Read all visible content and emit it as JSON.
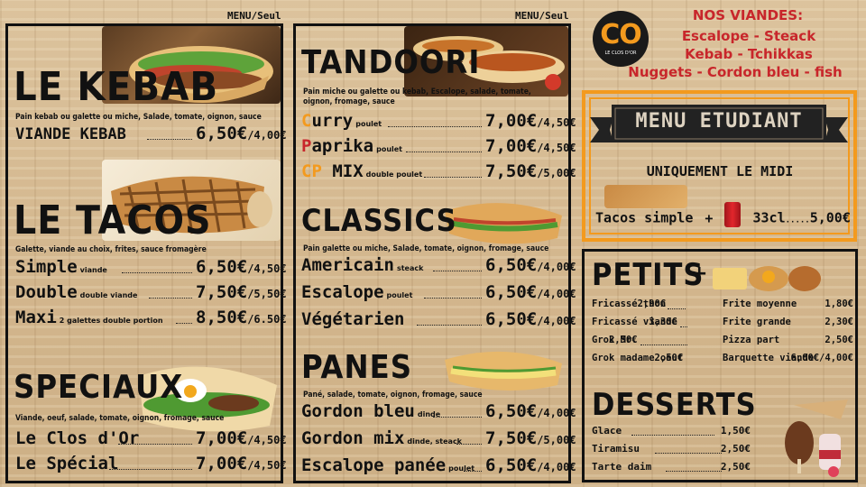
{
  "top_tags": {
    "left": "MENU/Seul",
    "middle": "MENU/Seul"
  },
  "kebab": {
    "title": "LE KEBAB",
    "desc": "Pain kebab ou galette ou miche, Salade, tomate, oignon, sauce",
    "items": [
      {
        "name": "VIANDE KEBAB",
        "sub": "",
        "price": "6,50€",
        "menu": "/4,00€"
      }
    ]
  },
  "tacos": {
    "title": "LE TACOS",
    "desc": "Galette, viande au choix, frites, sauce fromagère",
    "items": [
      {
        "name": "Simple",
        "sub": "viande",
        "price": "6,50€",
        "menu": "/4,50€"
      },
      {
        "name": "Double",
        "sub": "double viande",
        "price": "7,50€",
        "menu": "/5,50€"
      },
      {
        "name": "Maxi",
        "sub": "2 galettes double portion",
        "price": "8,50€",
        "menu": "/6.50€"
      }
    ]
  },
  "speciaux": {
    "title": "SPECIAUX",
    "desc": "Viande, oeuf, salade, tomate, oignon, fromage, sauce",
    "items": [
      {
        "name": "Le Clos d'Or",
        "sub": "",
        "price": "7,00€",
        "menu": "/4,50€"
      },
      {
        "name": "Le Spécial",
        "sub": "",
        "price": "7,00€",
        "menu": "/4,50€"
      }
    ]
  },
  "tandoori": {
    "title": "TANDOORI",
    "desc1": "Pain miche ou galette ou kebab, Escalope, salade, tomate,",
    "desc2": "oignon, fromage, sauce",
    "items": [
      {
        "first": "C",
        "rest": "urry",
        "sub": "poulet",
        "price": "7,00€",
        "menu": "/4,50€"
      },
      {
        "first": "P",
        "rest": "aprika",
        "sub": "poulet",
        "price": "7,00€",
        "menu": "/4,50€"
      },
      {
        "first": "CP",
        "rest": " MIX",
        "sub": "double poulet",
        "price": "7,50€",
        "menu": "/5,00€"
      }
    ]
  },
  "classics": {
    "title": "CLASSICS",
    "desc": "Pain galette ou miche, Salade, tomate, oignon, fromage, sauce",
    "items": [
      {
        "name": "Americain",
        "sub": "steack",
        "price": "6,50€",
        "menu": "/4,00€"
      },
      {
        "name": "Escalope",
        "sub": "poulet",
        "price": "6,50€",
        "menu": "/4,00€"
      },
      {
        "name": "Végétarien",
        "sub": "",
        "price": "6,50€",
        "menu": "/4,00€"
      }
    ]
  },
  "panes": {
    "title": "PANES",
    "desc": "Pané, salade, tomate, oignon, fromage, sauce",
    "items": [
      {
        "name": "Gordon bleu",
        "sub": "dinde",
        "price": "6,50€",
        "menu": "/4,00€"
      },
      {
        "name": "Gordon mix",
        "sub": "dinde, steack",
        "price": "7,50€",
        "menu": "/5,00€"
      },
      {
        "name": "Escalope panée",
        "sub": "poulet",
        "price": "6,50€",
        "menu": "/4,00€"
      }
    ]
  },
  "logo": {
    "letters": "CO",
    "caption": "LE CLOS D'OR"
  },
  "viandes": {
    "title": "NOS VIANDES:",
    "lines": [
      "Escalope - Steack",
      "Kebab - Tchikkas",
      "Nuggets - Cordon bleu - fish"
    ]
  },
  "etudiant": {
    "banner": "MENU ETUDIANT",
    "subtitle": "UNIQUEMENT LE MIDI",
    "offer_item": "Tacos simple",
    "plus": "+",
    "drink": "33cl",
    "price": "5,00€"
  },
  "petits": {
    "title": "PETITS",
    "plus": "+",
    "left": [
      {
        "name": "Fricassé thon",
        "price": "2,90€"
      },
      {
        "name": "Fricassé viande",
        "price": "3,30€"
      },
      {
        "name": "Grok Mr.",
        "price": "2,50€"
      },
      {
        "name": "Grok madame oeuf",
        "price": "2,50€"
      }
    ],
    "right": [
      {
        "name": "Frite moyenne",
        "price": "1,80€"
      },
      {
        "name": "Frite grande",
        "price": "2,30€"
      },
      {
        "name": "Pizza part",
        "price": "2,50€"
      },
      {
        "name": "Barquette viande",
        "price": "6,00€/4,00€"
      }
    ]
  },
  "desserts": {
    "title": "DESSERTS",
    "items": [
      {
        "name": "Glace",
        "price": "1,50€"
      },
      {
        "name": "Tiramisu",
        "price": "2,50€"
      },
      {
        "name": "Tarte daim",
        "price": "2,50€"
      }
    ]
  },
  "colors": {
    "accent_red": "#c8262b",
    "accent_orange": "#f39a1e",
    "ink": "#111111"
  }
}
